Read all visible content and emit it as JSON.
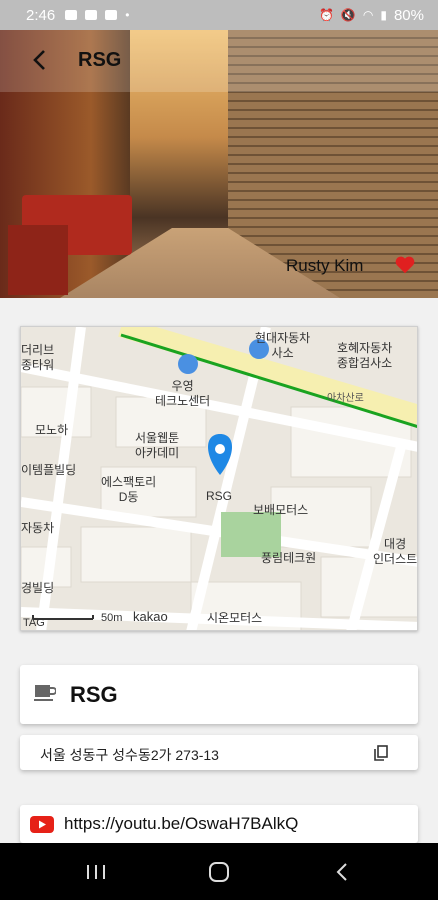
{
  "status_bar": {
    "time": "2:46",
    "battery": "80%"
  },
  "header": {
    "title": "RSG",
    "owner": "Rusty Kim"
  },
  "map": {
    "labels": [
      {
        "text": "더리브\n종타워"
      },
      {
        "text": "현대자동차\n사소"
      },
      {
        "text": "호혜자동차\n종합검사소"
      },
      {
        "text": "우영\n테크노센터"
      },
      {
        "text": "아차산로"
      },
      {
        "text": "모노하"
      },
      {
        "text": "서울웹툰\n아카데미"
      },
      {
        "text": "이템플빌딩"
      },
      {
        "text": "에스팩토리\nD동"
      },
      {
        "text": "RSG"
      },
      {
        "text": "보배모터스"
      },
      {
        "text": "자동차"
      },
      {
        "text": "풍림테크원"
      },
      {
        "text": "대경\n인더스트"
      },
      {
        "text": "경빌딩"
      },
      {
        "text": "시온모터스"
      },
      {
        "text": "50m"
      },
      {
        "text": "kakao"
      },
      {
        "text": "TAG"
      }
    ]
  },
  "place": {
    "name": "RSG",
    "address": "서울 성동구 성수동2가 273-13",
    "youtube_url": "https://youtu.be/OswaH7BAlkQ"
  },
  "colors": {
    "heart": "#e02020",
    "pin": "#1e88e5",
    "youtube": "#e62117"
  },
  "icons": {
    "back": "arrow-back-icon",
    "favorite": "heart-icon",
    "place_type": "coffee-cup-icon",
    "copy": "copy-icon",
    "youtube": "youtube-icon"
  }
}
